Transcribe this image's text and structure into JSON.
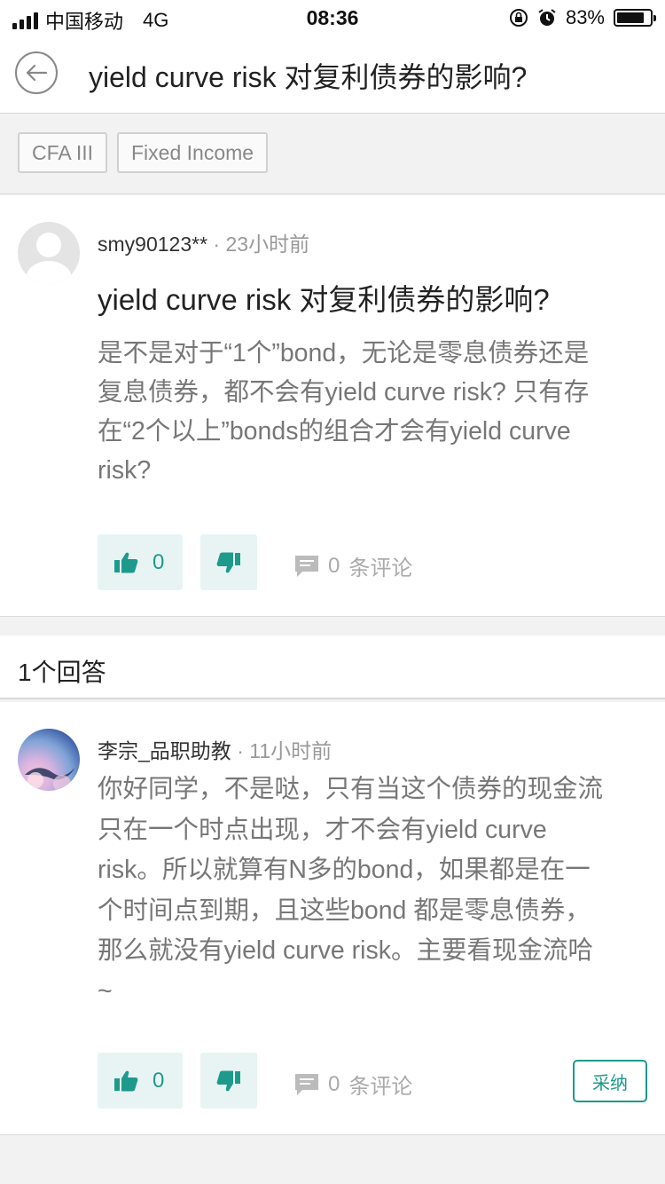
{
  "status_bar": {
    "carrier": "中国移动",
    "network": "4G",
    "time": "08:36",
    "battery_percent": "83%",
    "battery_level": 0.83
  },
  "nav": {
    "title": "yield curve risk 对复利债券的影响?",
    "back_icon": "back-arrow-icon"
  },
  "tags": [
    "CFA III",
    "Fixed Income"
  ],
  "question": {
    "author": "smy90123**",
    "separator": "·",
    "time": "23小时前",
    "title": "yield curve risk 对复利债券的影响?",
    "lines": [
      "是不是对于“1个”bond，无论是零息债券还是",
      "复息债券，都不会有yield curve risk? 只有存",
      "在“2个以上”bonds的组合才会有yield curve",
      "risk?"
    ],
    "likes": "0",
    "comments_count": "0",
    "comments_label": "条评论"
  },
  "answers_header": "1个回答",
  "answer": {
    "author": "李宗_品职助教",
    "separator": "·",
    "time": "11小时前",
    "lines": [
      "你好同学，不是哒，只有当这个债券的现金流",
      "只在一个时点出现，才不会有yield curve",
      "risk。所以就算有N多的bond，如果都是在一",
      "个时间点到期，且这些bond 都是零息债券，",
      "那么就没有yield curve risk。主要看现金流哈",
      "~"
    ],
    "likes": "0",
    "comments_count": "0",
    "comments_label": "条评论",
    "adopt_label": "采纳"
  },
  "colors": {
    "accent": "#1d9a8c",
    "vote_bg": "#e8f4f3",
    "page_bg": "#f2f2f2"
  }
}
